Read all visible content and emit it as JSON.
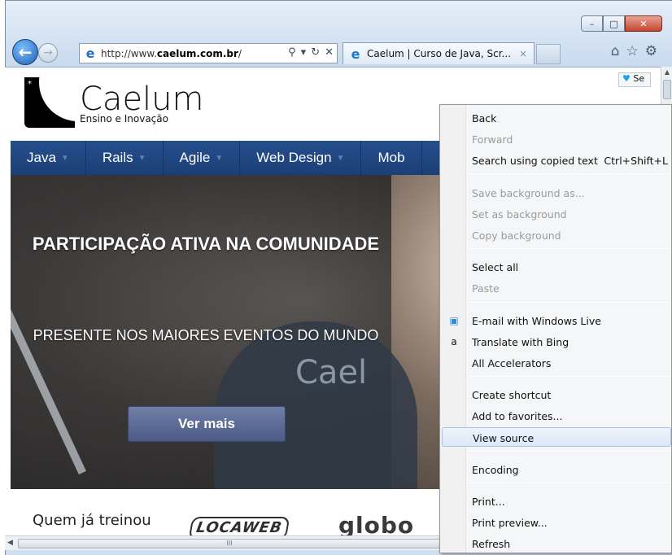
{
  "browser": {
    "url_prefix": "http://www.",
    "url_domain": "caelum.com.br",
    "url_suffix": "/",
    "tab_title": "Caelum | Curso de Java, Scr...",
    "tab_close": "×",
    "back_glyph": "←",
    "forward_glyph": "→",
    "address_tools": [
      "⚲",
      "▾",
      "↻",
      "✕"
    ],
    "right_icons": [
      "⌂",
      "☆",
      "⚙"
    ],
    "caption": {
      "minimize": "–",
      "maximize": "□",
      "close": "✕"
    },
    "icon_names": {
      "back": "back-arrow-icon",
      "forward": "forward-arrow-icon",
      "site": "ie-logo-icon",
      "home": "home-icon",
      "favorites": "star-icon",
      "tools": "gear-icon"
    }
  },
  "site": {
    "logo_name": "Caelum",
    "logo_tagline": "Ensino e Inovação",
    "logo_star": "*",
    "social_label": "Se",
    "nav": [
      {
        "label": "Java"
      },
      {
        "label": "Rails"
      },
      {
        "label": "Agile"
      },
      {
        "label": "Web Design"
      },
      {
        "label": "Mob"
      }
    ],
    "nav_arrow": "▼",
    "hero_title": "PARTICIPAÇÃO ATIVA NA COMUNIDADE",
    "hero_subtitle": "PRESENTE NOS MAIORES EVENTOS DO MUNDO",
    "hero_shirt": "Cael",
    "hero_button": "Ver mais",
    "trained_label": "Quem já treinou",
    "client_logos": [
      "LOCAWEB",
      "globo"
    ]
  },
  "scrollbars": {
    "up_arrow": "▲",
    "left_arrow": "◀",
    "grip": "III"
  },
  "context_menu": {
    "items": [
      {
        "label": "Back",
        "enabled": true
      },
      {
        "label": "Forward",
        "enabled": false
      },
      {
        "label": "Search using copied text",
        "shortcut": "Ctrl+Shift+L",
        "enabled": true
      },
      {
        "label": "Save background as...",
        "enabled": false
      },
      {
        "label": "Set as background",
        "enabled": false
      },
      {
        "label": "Copy background",
        "enabled": false
      },
      {
        "label": "Select all",
        "enabled": true
      },
      {
        "label": "Paste",
        "enabled": false
      },
      {
        "label": "E-mail with Windows Live",
        "enabled": true,
        "icon": "email-icon"
      },
      {
        "label": "Translate with Bing",
        "enabled": true,
        "icon": "translate-icon"
      },
      {
        "label": "All Accelerators",
        "enabled": true
      },
      {
        "label": "Create shortcut",
        "enabled": true
      },
      {
        "label": "Add to favorites...",
        "enabled": true
      },
      {
        "label": "View source",
        "enabled": true,
        "highlighted": true
      },
      {
        "label": "Encoding",
        "enabled": true
      },
      {
        "label": "Print...",
        "enabled": true
      },
      {
        "label": "Print preview...",
        "enabled": true
      },
      {
        "label": "Refresh",
        "enabled": true
      }
    ]
  },
  "colors": {
    "nav_bg": "#1c3f75",
    "hero_button": "#4b5b85",
    "menu_hover_border": "#a8c4e4"
  }
}
